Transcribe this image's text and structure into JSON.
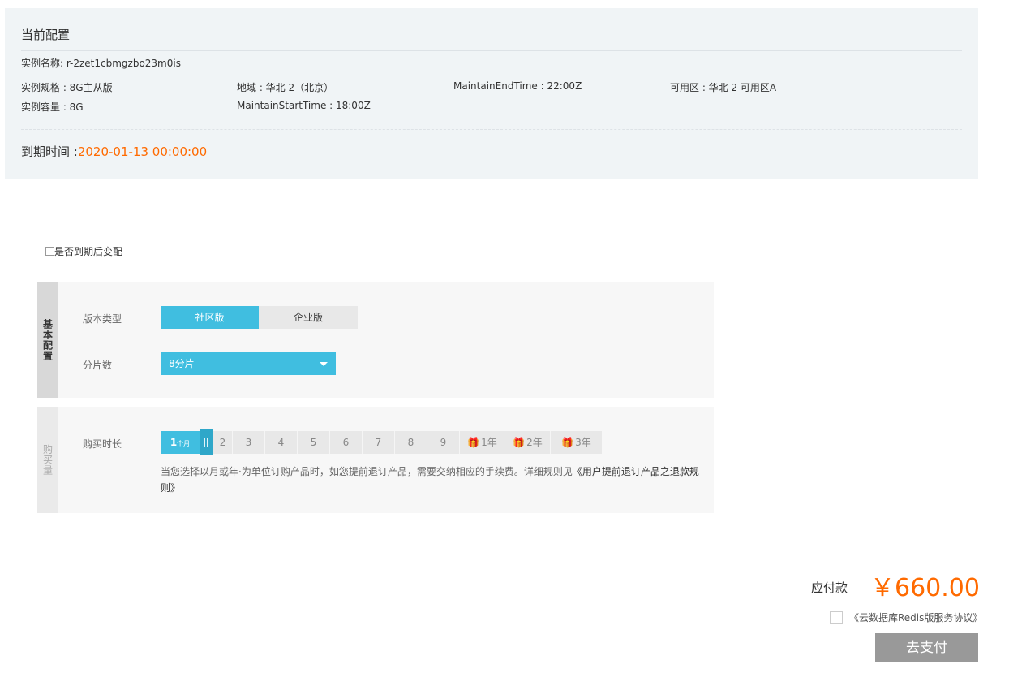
{
  "config": {
    "title": "当前配置",
    "instance_name": "实例名称: r-2zet1cbmgzbo23m0is",
    "spec": "实例规格 : 8G主从版",
    "region": "地域 : 华北 2（北京）",
    "maintain_end": "MaintainEndTime : 22:00Z",
    "zone": "可用区 : 华北 2 可用区A",
    "capacity": "实例容量 : 8G",
    "maintain_start": "MaintainStartTime : 18:00Z",
    "expire_label": "到期时间 :",
    "expire_value": "2020-01-13 00:00:00"
  },
  "renew_change": {
    "label": "是否到期后变配",
    "checked": false
  },
  "basic": {
    "section_label": "基本配置",
    "version_label": "版本类型",
    "versions": [
      {
        "label": "社区版",
        "selected": true
      },
      {
        "label": "企业版",
        "selected": false
      }
    ],
    "shard_label": "分片数",
    "shard_value": "8分片"
  },
  "purchase": {
    "section_label": "购买量",
    "duration_label": "购买时长",
    "current_value": "1",
    "current_unit": "个月",
    "ticks": [
      {
        "label": "2",
        "gift": false
      },
      {
        "label": "3",
        "gift": false
      },
      {
        "label": "4",
        "gift": false
      },
      {
        "label": "5",
        "gift": false
      },
      {
        "label": "6",
        "gift": false
      },
      {
        "label": "7",
        "gift": false
      },
      {
        "label": "8",
        "gift": false
      },
      {
        "label": "9",
        "gift": false
      },
      {
        "label": "1年",
        "gift": true
      },
      {
        "label": "2年",
        "gift": true
      },
      {
        "label": "3年",
        "gift": true
      }
    ],
    "note": "当您选择以月或年·为单位订购产品时，如您提前退订产品，需要交纳相应的手续费。详细规则见",
    "note_link": "《用户提前退订产品之退款规则》"
  },
  "payment": {
    "label": "应付款",
    "amount": "￥660.00",
    "agreement": "《云数据库Redis版服务协议》",
    "pay_button": "去支付"
  },
  "colors": {
    "accent": "#40bee0",
    "price": "#ff6a00",
    "panel": "#f0f4f6",
    "pay_button": "#999999"
  }
}
